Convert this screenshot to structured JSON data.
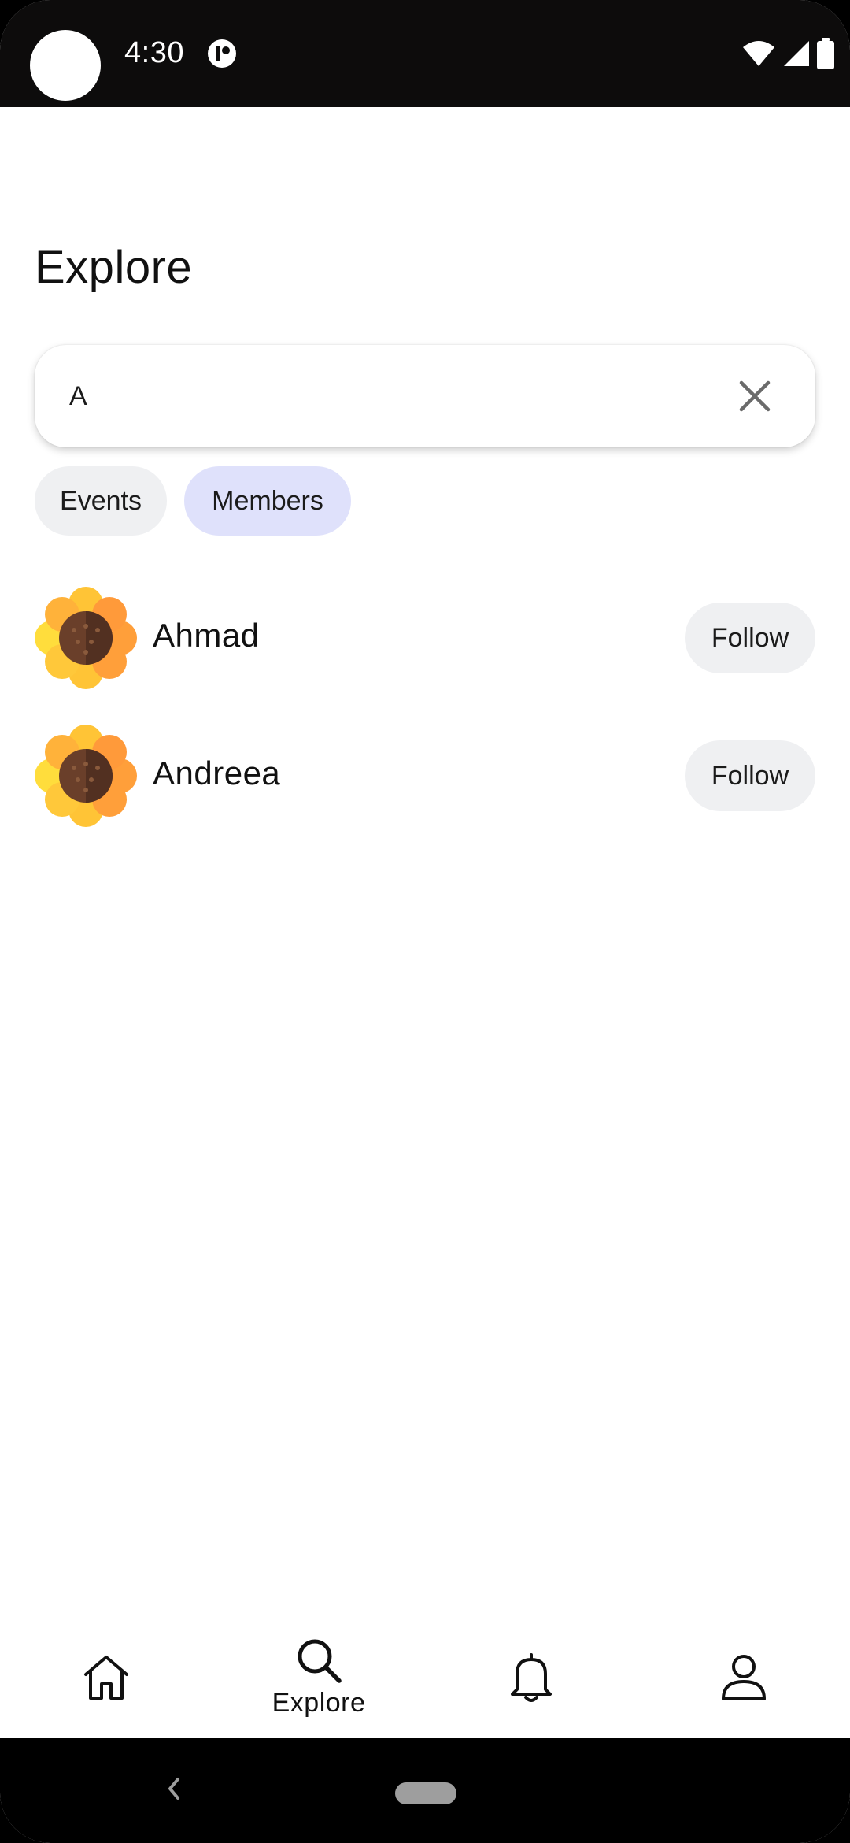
{
  "status_bar": {
    "time": "4:30"
  },
  "page": {
    "title": "Explore"
  },
  "search": {
    "value": "A"
  },
  "filters": {
    "chips": [
      {
        "label": "Events",
        "selected": false
      },
      {
        "label": "Members",
        "selected": true
      }
    ]
  },
  "members": [
    {
      "name": "Ahmad",
      "follow_label": "Follow",
      "avatar_icon": "sunflower-icon"
    },
    {
      "name": "Andreea",
      "follow_label": "Follow",
      "avatar_icon": "sunflower-icon"
    }
  ],
  "bottom_nav": {
    "items": [
      {
        "icon": "home-icon",
        "label": ""
      },
      {
        "icon": "search-icon",
        "label": "Explore",
        "active": true
      },
      {
        "icon": "bell-icon",
        "label": ""
      },
      {
        "icon": "profile-icon",
        "label": ""
      }
    ]
  },
  "colors": {
    "chip_default": "#eff0f2",
    "chip_selected": "#dfe1fb",
    "status_bar": "#0d0c0c"
  }
}
